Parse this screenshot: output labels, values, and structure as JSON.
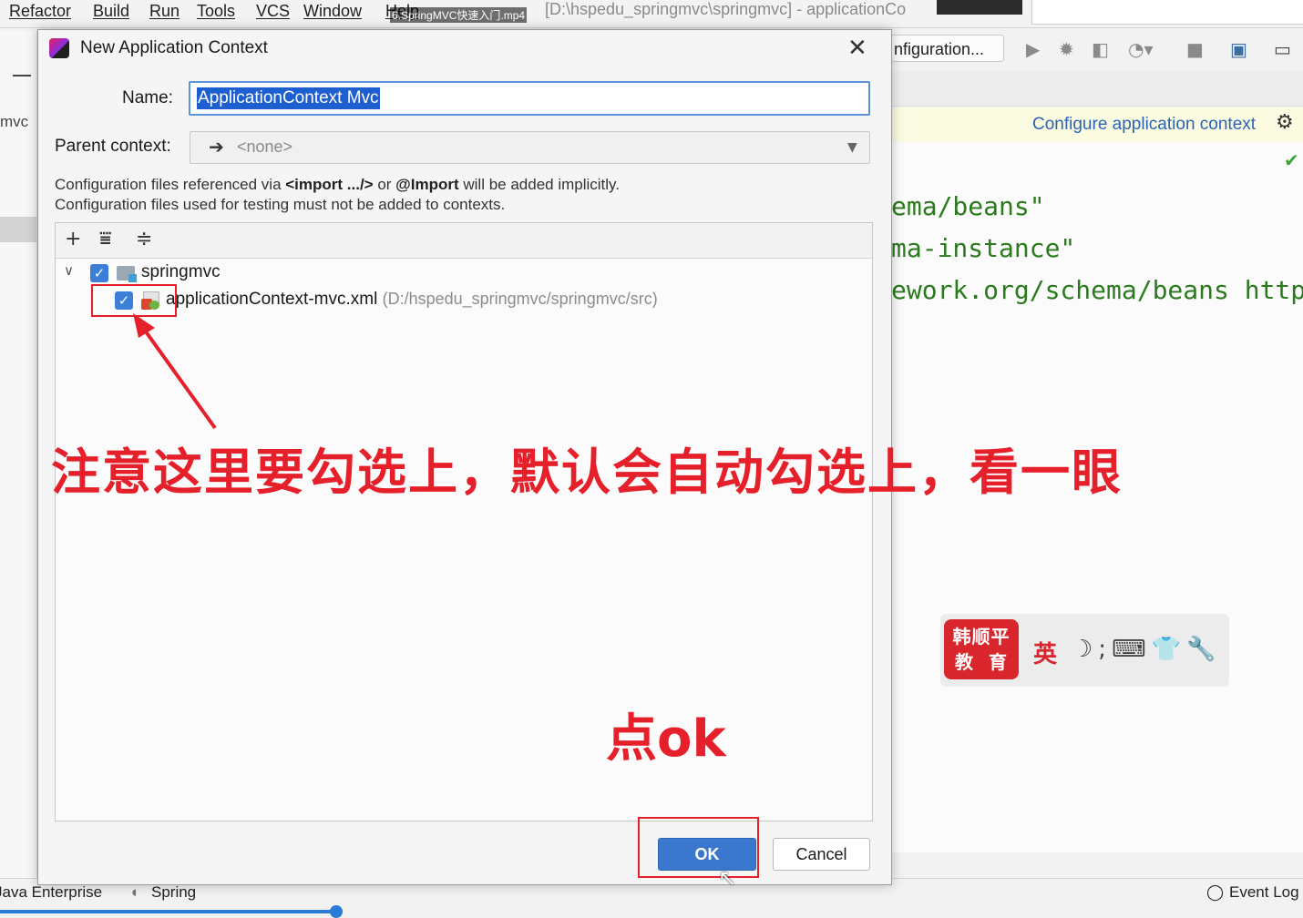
{
  "ide": {
    "menu": [
      "Refactor",
      "Build",
      "Run",
      "Tools",
      "VCS",
      "Window",
      "Help"
    ],
    "video_title": "6.SpringMVC快速入门.mp4",
    "window_title": "[D:\\hspedu_springmvc\\springmvc] - applicationCo",
    "run_config": "nfiguration...",
    "left_label": "mvc",
    "banner_link": "Configure application context",
    "code_lines": [
      "ema/beans\"",
      "ma-instance\"",
      "ework.org/schema/beans http"
    ],
    "status_left": "Java Enterprise",
    "status_spring": "Spring",
    "event_log": "Event Log",
    "status_icons": {
      "toolbar": [
        "run-icon",
        "debug-icon",
        "coverage-icon",
        "profile-icon",
        "stop-icon",
        "project-structure-icon",
        "panel-icon"
      ]
    }
  },
  "dialog": {
    "title": "New Application Context",
    "name_label": "Name:",
    "name_value": "ApplicationContext Mvc",
    "parent_label": "Parent context:",
    "parent_value": "<none>",
    "info_line1": {
      "a": "Configuration files referenced via ",
      "b": "<import .../>",
      "c": " or ",
      "d": "@Import",
      "e": " will be added implicitly."
    },
    "info_line2": "Configuration files used for testing must not be added to contexts.",
    "tree": {
      "module": "springmvc",
      "module_checked": true,
      "file_name": "applicationContext-mvc.xml",
      "file_path": "(D:/hspedu_springmvc/springmvc/src)",
      "file_checked": true
    },
    "ok_label": "OK",
    "cancel_label": "Cancel"
  },
  "annotations": {
    "main": "注意这里要勾选上，默认会自动勾选上，看一眼",
    "ok_hint": "点ok"
  },
  "watermark": {
    "logo": "韩顺平\n教 育",
    "ime": "英"
  },
  "colors": {
    "annotation_red": "#e5202a",
    "accent_blue": "#3a78cf",
    "code_green": "#2b7a1e"
  }
}
